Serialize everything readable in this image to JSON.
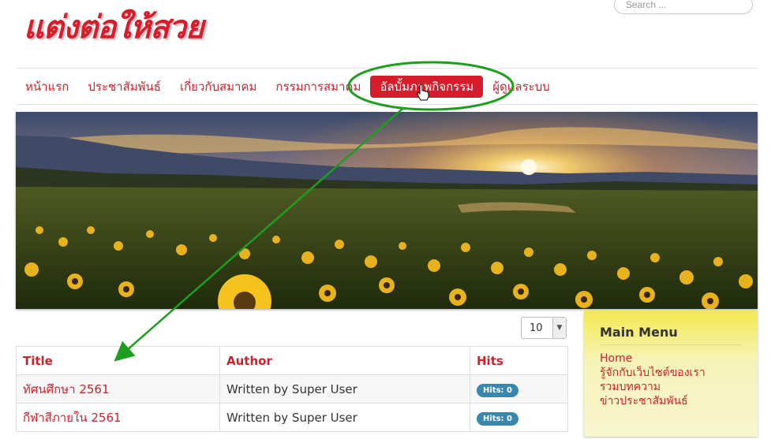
{
  "site": {
    "logo_text": "แต่งต่อให้สวย"
  },
  "search": {
    "placeholder": "Search ..."
  },
  "nav": {
    "items": [
      {
        "label": "หน้าแรก"
      },
      {
        "label": "ประชาสัมพันธ์"
      },
      {
        "label": "เกี่ยวกับสมาคม"
      },
      {
        "label": "กรรมการสมาคม"
      },
      {
        "label": "อัลบั้มภาพกิจกรรม",
        "active": true
      },
      {
        "label": "ผู้ดูแลระบบ"
      }
    ]
  },
  "banner": {
    "image": "sunflower-field-sunset"
  },
  "list_limit": {
    "selected": "10"
  },
  "table": {
    "headers": [
      "Title",
      "Author",
      "Hits"
    ],
    "rows": [
      {
        "title": "ทัศนศึกษา 2561",
        "author": "Written by Super User",
        "hits": "Hits: 0"
      },
      {
        "title": "กีฬาสีภายใน 2561",
        "author": "Written by Super User",
        "hits": "Hits: 0"
      }
    ]
  },
  "sidebar": {
    "title": "Main Menu",
    "items": [
      {
        "label": "Home"
      },
      {
        "label": "รู้จักกับเว็บไซต์ของเรา"
      },
      {
        "label": "รวมบทความ"
      },
      {
        "label": "ข่าวประชาสัมพันธ์"
      }
    ]
  },
  "annotation": {
    "color": "#1e9e1e"
  },
  "colors": {
    "accent": "#c8242f",
    "active_nav": "#d51d2b",
    "badge": "#3a87ad",
    "sidebar_bg": "#f4e84f"
  }
}
